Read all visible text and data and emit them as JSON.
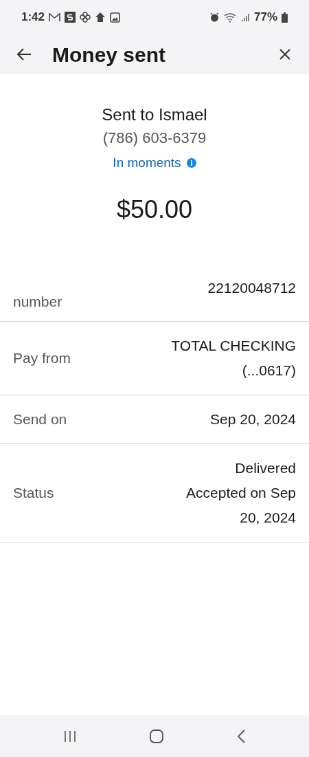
{
  "status_bar": {
    "time": "1:42",
    "battery": "77%"
  },
  "header": {
    "title": "Money sent"
  },
  "summary": {
    "recipient": "Sent to Ismael",
    "phone": "(786) 603-6379",
    "timing": "In moments",
    "amount": "$50.00"
  },
  "details": [
    {
      "label": "number",
      "value": [
        "22120048712"
      ]
    },
    {
      "label": "Pay from",
      "value": [
        "TOTAL CHECKING",
        "(...0617)"
      ]
    },
    {
      "label": "Send on",
      "value": [
        "Sep 20, 2024"
      ]
    },
    {
      "label": "Status",
      "value": [
        "Delivered",
        "Accepted on Sep 20, 2024"
      ]
    }
  ]
}
